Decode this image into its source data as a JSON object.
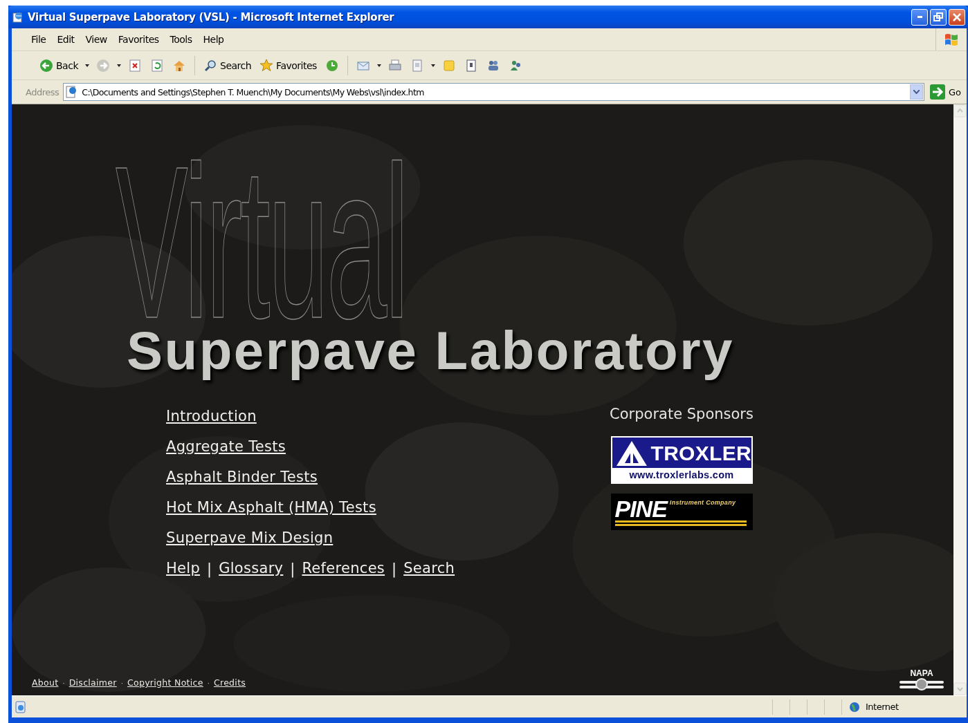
{
  "window": {
    "title": "Virtual Superpave Laboratory (VSL) - Microsoft Internet Explorer"
  },
  "menu": [
    "File",
    "Edit",
    "View",
    "Favorites",
    "Tools",
    "Help"
  ],
  "toolbar": [
    {
      "kind": "back",
      "label": "Back",
      "dropdown": true
    },
    {
      "kind": "forward",
      "dropdown": true
    },
    {
      "kind": "stop",
      "dropdown": false
    },
    {
      "kind": "refresh",
      "dropdown": false
    },
    {
      "kind": "home",
      "dropdown": false
    },
    {
      "kind": "search",
      "label": "Search",
      "dropdown": false
    },
    {
      "kind": "favorites",
      "label": "Favorites",
      "dropdown": false
    },
    {
      "kind": "history",
      "dropdown": false
    },
    {
      "kind": "mail",
      "dropdown": true
    },
    {
      "kind": "print",
      "dropdown": false
    },
    {
      "kind": "edit",
      "dropdown": true
    },
    {
      "kind": "discuss",
      "dropdown": false
    },
    {
      "kind": "research",
      "dropdown": false
    },
    {
      "kind": "messenger",
      "dropdown": false
    },
    {
      "kind": "tools",
      "dropdown": false
    }
  ],
  "address": {
    "label": "Address",
    "value": "C:\\Documents and Settings\\Stephen T. Muench\\My Documents\\My Webs\\vsl\\index.htm",
    "go": "Go"
  },
  "page": {
    "background": {
      "kind": "picture"
    },
    "title_top": "Virtual",
    "title_main": "Superpave Laboratory",
    "nav": [
      "Introduction",
      "Aggregate Tests",
      "Asphalt Binder Tests",
      "Hot Mix Asphalt (HMA) Tests",
      "Superpave Mix Design"
    ],
    "nav_inline": {
      "separator": "|",
      "links": [
        "Help",
        "Glossary",
        "References",
        "Search"
      ]
    },
    "sponsors": {
      "heading": "Corporate Sponsors",
      "logos": [
        {
          "kind": "troxler",
          "name": "TROXLER",
          "url": "www.troxlerlabs.com"
        },
        {
          "kind": "pine",
          "name": "PINE",
          "subtitle": "Instrument Company"
        }
      ]
    },
    "footer": {
      "separator": "·",
      "links": [
        "About",
        "Disclaimer",
        "Copyright Notice",
        "Credits"
      ],
      "logo": "NAPA"
    }
  },
  "status_bar": {
    "zone": "Internet"
  }
}
